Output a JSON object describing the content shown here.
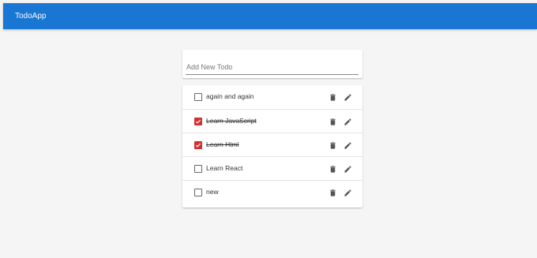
{
  "appbar": {
    "title": "TodoApp",
    "color": "#1976d2"
  },
  "add_todo": {
    "placeholder": "Add New Todo",
    "value": ""
  },
  "todos": [
    {
      "text": "again and again",
      "completed": false
    },
    {
      "text": "Learn JavaScript",
      "completed": true
    },
    {
      "text": "Learn Html",
      "completed": true
    },
    {
      "text": "Learn React",
      "completed": false
    },
    {
      "text": "new",
      "completed": false
    }
  ],
  "colors": {
    "checked": "#d32f2f",
    "icon": "#555555"
  },
  "icons": {
    "delete": "trash-icon",
    "edit": "pencil-icon",
    "check": "checkmark-icon"
  }
}
